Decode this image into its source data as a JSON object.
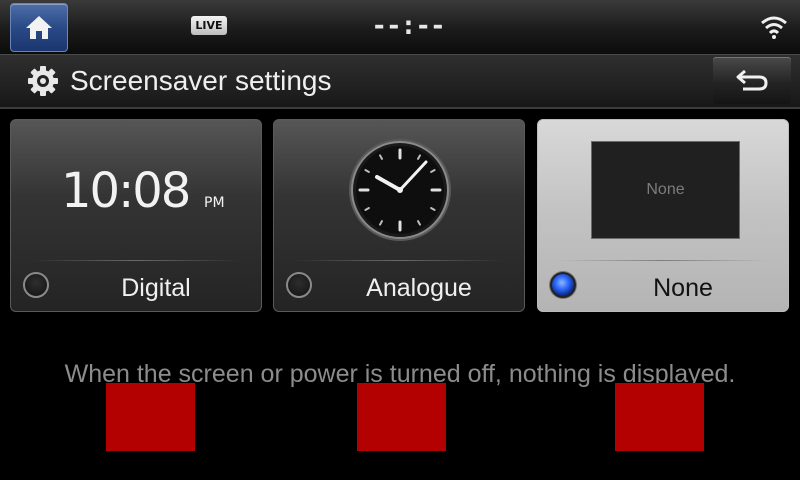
{
  "statusbar": {
    "live_label": "LIVE",
    "clock": "--:--",
    "home_icon": "home-icon",
    "wifi_icon": "wifi-icon"
  },
  "titlebar": {
    "title": "Screensaver settings",
    "settings_icon": "gear-icon",
    "back_icon": "back-arrow-icon"
  },
  "options": [
    {
      "label": "Digital",
      "selected": false,
      "preview_time": "10:08",
      "preview_ampm": "PM"
    },
    {
      "label": "Analogue",
      "selected": false
    },
    {
      "label": "None",
      "selected": true,
      "preview_text": "None"
    }
  ],
  "description": "When the screen or power is turned off, nothing is displayed.",
  "colors": {
    "home_button": "#2a4a86",
    "radio_selected": "#2f6cff",
    "red_overlay": "#b30000"
  }
}
